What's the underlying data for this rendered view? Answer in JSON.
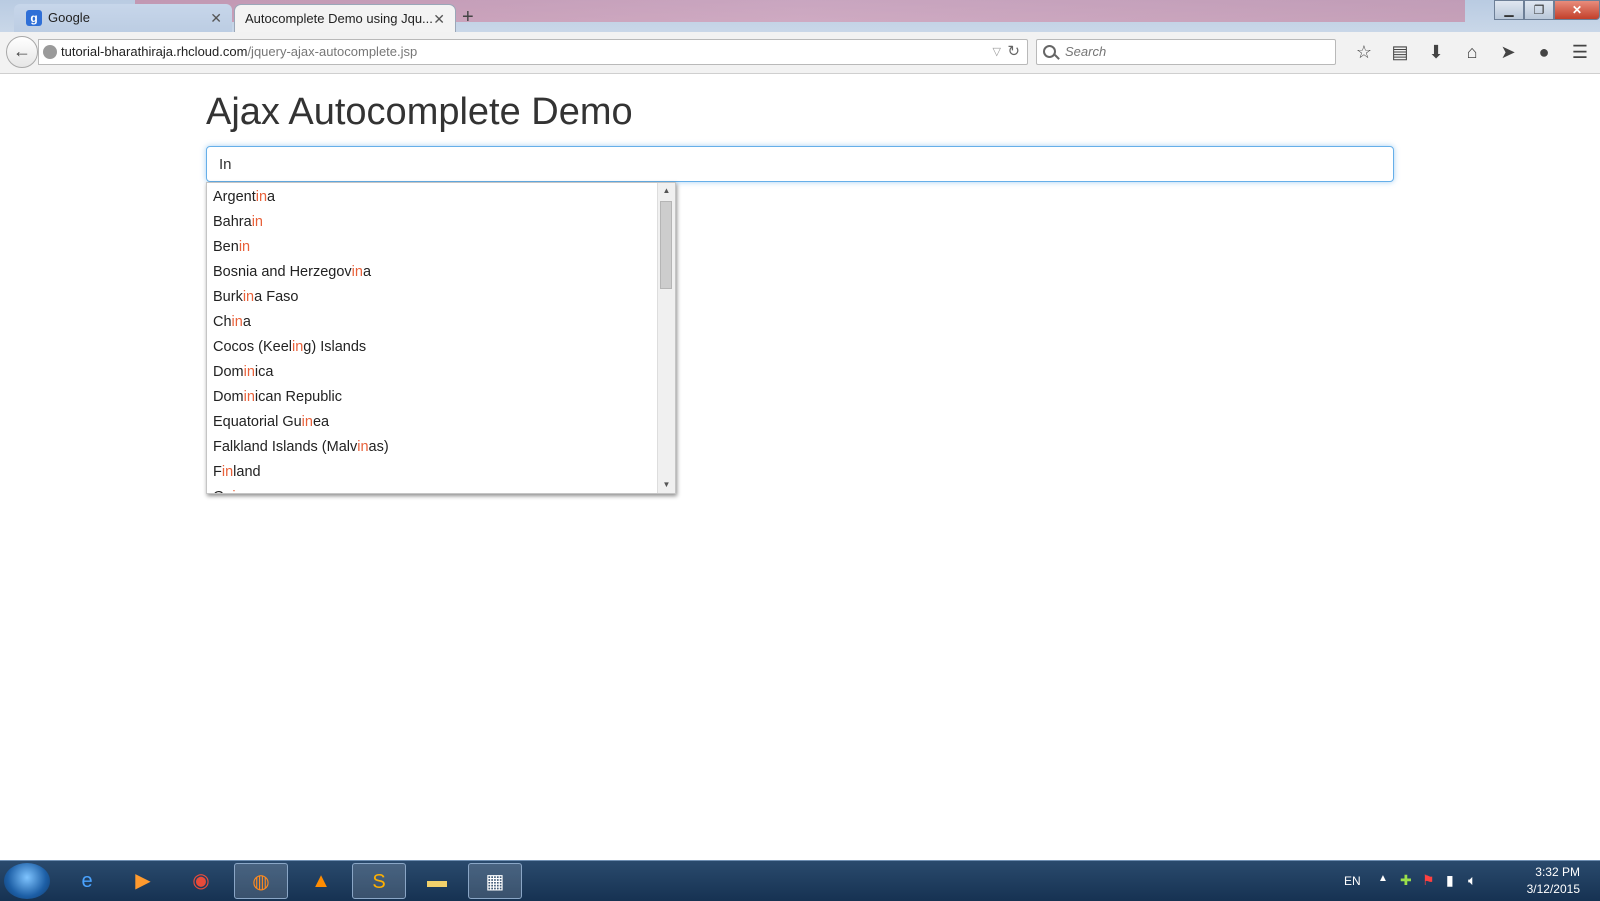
{
  "browser": {
    "tabs": [
      {
        "title": "Google",
        "favicon": "google-icon"
      },
      {
        "title": "Autocomplete Demo using Jqu...",
        "favicon": ""
      }
    ],
    "url_host": "tutorial-bharathiraja.rhcloud.com",
    "url_path": "/jquery-ajax-autocomplete.jsp",
    "search_placeholder": "Search"
  },
  "page": {
    "title": "Ajax Autocomplete Demo",
    "input_value": "In",
    "highlight_color": "#e8613a",
    "suggestions": [
      [
        "Argent",
        "in",
        "a"
      ],
      [
        "Bahra",
        "in",
        ""
      ],
      [
        "Ben",
        "in",
        ""
      ],
      [
        "Bosnia and Herzegov",
        "in",
        "a"
      ],
      [
        "Burk",
        "in",
        "a Faso"
      ],
      [
        "Ch",
        "in",
        "a"
      ],
      [
        "Cocos (Keel",
        "in",
        "g) Islands"
      ],
      [
        "Dom",
        "in",
        "ica"
      ],
      [
        "Dom",
        "in",
        "ican Republic"
      ],
      [
        "Equatorial Gu",
        "in",
        "ea"
      ],
      [
        "Falkland Islands (Malv",
        "in",
        "as)"
      ],
      [
        "F",
        "in",
        "land"
      ],
      [
        "Gu",
        "in",
        "ea"
      ]
    ]
  },
  "taskbar": {
    "language": "EN",
    "time": "3:32 PM",
    "date": "3/12/2015"
  }
}
